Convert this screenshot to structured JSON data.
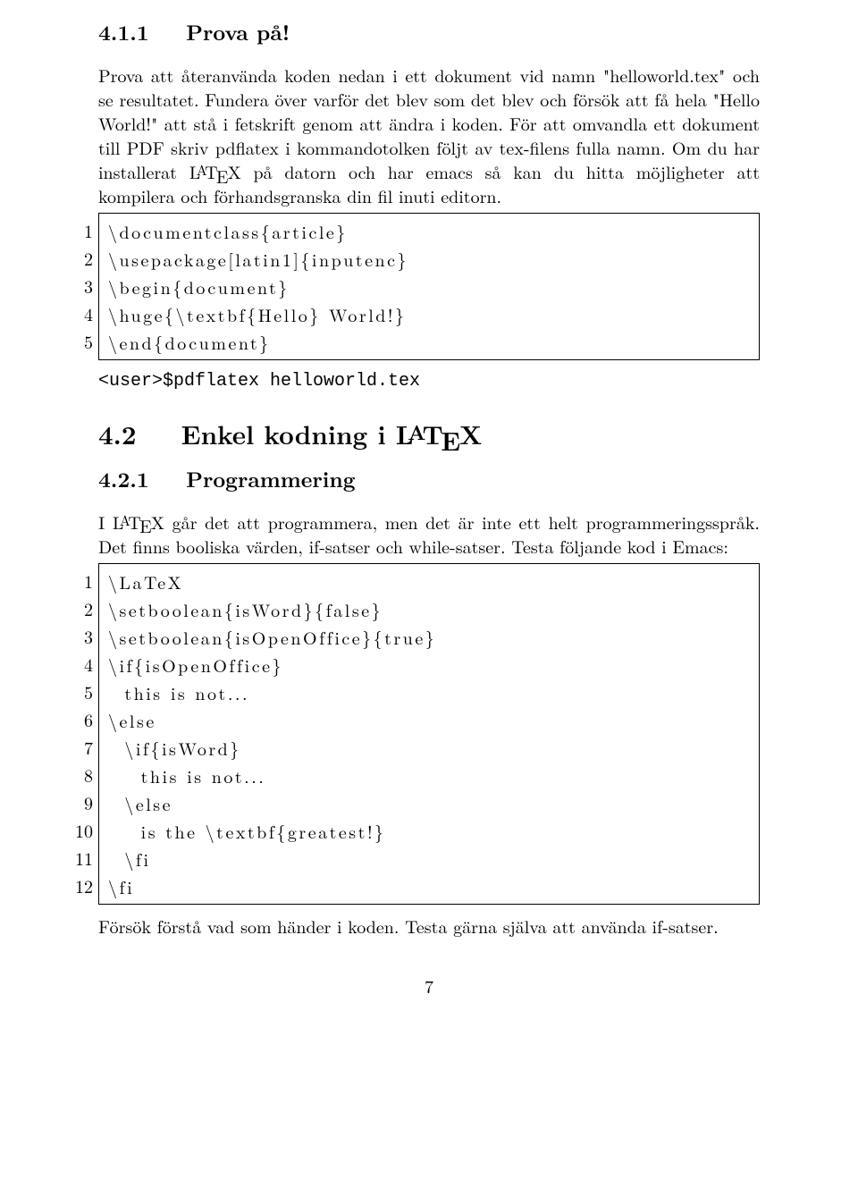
{
  "sec411_num": "4.1.1",
  "sec411_title": "Prova på!",
  "para1_a": "Prova att återanvända koden nedan i ett dokument vid namn \"helloworld.tex\" och se resultatet. Fundera över varför det blev som det blev och försök att få hela \"Hello World!\" att stå i fetskrift genom att ändra i koden. För att omvandla ett dokument till PDF skriv pdflatex i kommandotolken följt av tex-filens fulla namn. Om du har installerat ",
  "para1_b": " på datorn och har emacs så kan du hitta möjligheter att kompilera och förhandsgranska din fil inuti editorn.",
  "code1_lines": [
    "1",
    "2",
    "3",
    "4",
    "5"
  ],
  "code1": {
    "l1": "\\documentclass{article}",
    "l2": "\\usepackage[latin1]{inputenc}",
    "l3": "\\begin{document}",
    "l4": "\\huge{\\textbf{Hello} World!}",
    "l5": "\\end{document}"
  },
  "tt_line": "<user>$pdflatex helloworld.tex",
  "sec42_num": "4.2",
  "sec42_title_a": "Enkel kodning i ",
  "sec421_num": "4.2.1",
  "sec421_title": "Programmering",
  "para2_a": "I ",
  "para2_b": " går det att programmera, men det är inte ett helt programmeringsspråk. Det finns booliska värden, if-satser och while-satser. Testa följande kod i Emacs:",
  "code2_lines": [
    "1",
    "2",
    "3",
    "4",
    "5",
    "6",
    "7",
    "8",
    "9",
    "10",
    "11",
    "12"
  ],
  "code2": {
    "l1": "\\LaTeX",
    "l2": "\\setboolean{isWord}{false}",
    "l3": "\\setboolean{isOpenOffice}{true}",
    "l4": "\\if{isOpenOffice}",
    "l5": "  this is not...",
    "l6": "\\else",
    "l7": "  \\if{isWord}",
    "l8": "    this is not...",
    "l9": "  \\else",
    "l10": "    is the \\textbf{greatest!}",
    "l11": "  \\fi",
    "l12": "\\fi"
  },
  "para3": "Försök förstå vad som händer i koden. Testa gärna själva att använda if-satser.",
  "pagenum": "7"
}
